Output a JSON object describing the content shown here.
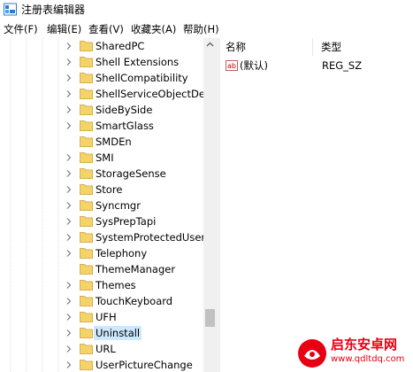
{
  "window": {
    "title": "注册表编辑器"
  },
  "menu": [
    {
      "label": "文件(F)"
    },
    {
      "label": "编辑(E)"
    },
    {
      "label": "查看(V)"
    },
    {
      "label": "收藏夹(A)"
    },
    {
      "label": "帮助(H)"
    }
  ],
  "tree": {
    "items": [
      {
        "label": "SharedPC",
        "expandable": true
      },
      {
        "label": "Shell Extensions",
        "expandable": true
      },
      {
        "label": "ShellCompatibility",
        "expandable": true
      },
      {
        "label": "ShellServiceObjectDela",
        "expandable": true
      },
      {
        "label": "SideBySide",
        "expandable": true
      },
      {
        "label": "SmartGlass",
        "expandable": true
      },
      {
        "label": "SMDEn",
        "expandable": false
      },
      {
        "label": "SMI",
        "expandable": true
      },
      {
        "label": "StorageSense",
        "expandable": true
      },
      {
        "label": "Store",
        "expandable": true
      },
      {
        "label": "Syncmgr",
        "expandable": true
      },
      {
        "label": "SysPrepTapi",
        "expandable": true
      },
      {
        "label": "SystemProtectedUserD",
        "expandable": true
      },
      {
        "label": "Telephony",
        "expandable": true
      },
      {
        "label": "ThemeManager",
        "expandable": false
      },
      {
        "label": "Themes",
        "expandable": true
      },
      {
        "label": "TouchKeyboard",
        "expandable": true
      },
      {
        "label": "UFH",
        "expandable": true
      },
      {
        "label": "Uninstall",
        "expandable": true,
        "selected": true
      },
      {
        "label": "URL",
        "expandable": true
      },
      {
        "label": "UserPictureChange",
        "expandable": true
      }
    ]
  },
  "list": {
    "columns": {
      "name": "名称",
      "type": "类型"
    },
    "rows": [
      {
        "name": "(默认)",
        "type": "REG_SZ",
        "icon": "string-value-icon"
      }
    ]
  },
  "watermark": {
    "name": "启东安卓网",
    "url": "www.qdltdq.com"
  },
  "colors": {
    "folder": "#f5d36b",
    "selection": "#cce8ff",
    "watermark": "#e60012"
  }
}
